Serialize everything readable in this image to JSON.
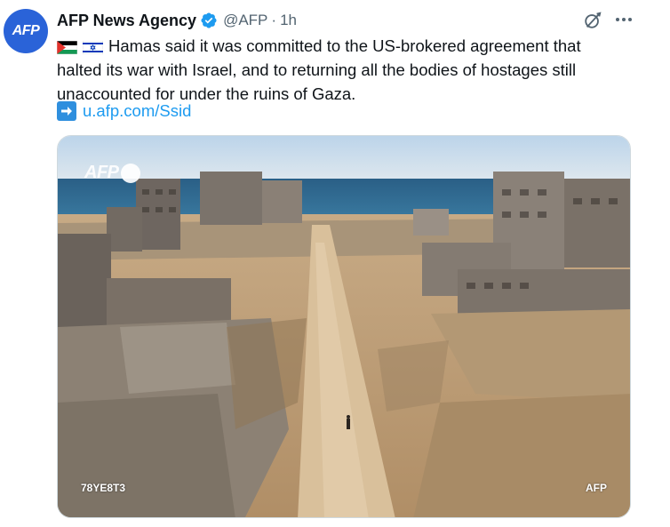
{
  "post": {
    "avatar_text": "AFP",
    "author_name": "AFP News Agency",
    "handle": "@AFP",
    "separator": "·",
    "time": "1h",
    "flags": [
      "palestine-flag",
      "israel-flag"
    ],
    "text": "Hamas said it was committed to the US-brokered agreement that halted its war with Israel, and to returning all the bodies of hostages still unaccounted for under the ruins of Gaza.",
    "link_icon": "right-arrow-icon",
    "link": "u.afp.com/Ssid",
    "media": {
      "watermark": "AFP",
      "code": "78YE8T3",
      "credit": "AFP"
    }
  },
  "colors": {
    "avatar_bg": "#2a63d8",
    "link": "#1d9bf0",
    "verified": "#1d9bf0",
    "muted": "#536471"
  }
}
